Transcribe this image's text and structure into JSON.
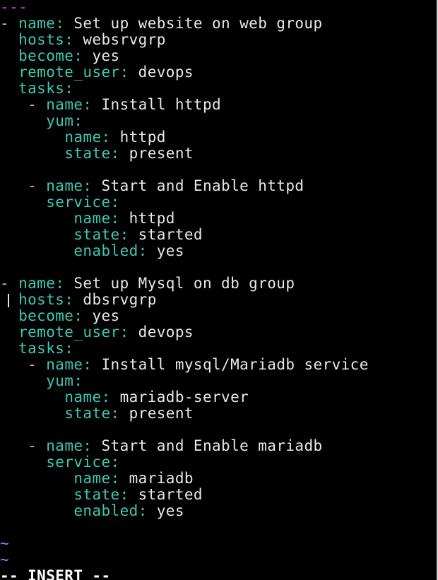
{
  "editor": {
    "lines": [
      [
        {
          "t": "---",
          "c": "m"
        }
      ],
      [
        {
          "t": "- ",
          "c": "d"
        },
        {
          "t": "name:",
          "c": "k"
        },
        {
          "t": " Set up website on web group",
          "c": "v"
        }
      ],
      [
        {
          "t": "  "
        },
        {
          "t": "hosts:",
          "c": "k"
        },
        {
          "t": " websrvgrp",
          "c": "v"
        }
      ],
      [
        {
          "t": "  "
        },
        {
          "t": "become:",
          "c": "k"
        },
        {
          "t": " yes",
          "c": "v"
        }
      ],
      [
        {
          "t": "  "
        },
        {
          "t": "remote_user:",
          "c": "k"
        },
        {
          "t": " devops",
          "c": "v"
        }
      ],
      [
        {
          "t": "  "
        },
        {
          "t": "tasks:",
          "c": "k"
        }
      ],
      [
        {
          "t": "   "
        },
        {
          "t": "- ",
          "c": "d"
        },
        {
          "t": "name:",
          "c": "k"
        },
        {
          "t": " Install httpd",
          "c": "v"
        }
      ],
      [
        {
          "t": "     "
        },
        {
          "t": "yum:",
          "c": "k"
        }
      ],
      [
        {
          "t": "       "
        },
        {
          "t": "name:",
          "c": "k"
        },
        {
          "t": " httpd",
          "c": "v"
        }
      ],
      [
        {
          "t": "       "
        },
        {
          "t": "state:",
          "c": "k"
        },
        {
          "t": " present",
          "c": "v"
        }
      ],
      [],
      [
        {
          "t": "   "
        },
        {
          "t": "- ",
          "c": "d"
        },
        {
          "t": "name:",
          "c": "k"
        },
        {
          "t": " Start and Enable httpd",
          "c": "v"
        }
      ],
      [
        {
          "t": "     "
        },
        {
          "t": "service:",
          "c": "k"
        }
      ],
      [
        {
          "t": "        "
        },
        {
          "t": "name:",
          "c": "k"
        },
        {
          "t": " httpd",
          "c": "v"
        }
      ],
      [
        {
          "t": "        "
        },
        {
          "t": "state:",
          "c": "k"
        },
        {
          "t": " started",
          "c": "v"
        }
      ],
      [
        {
          "t": "        "
        },
        {
          "t": "enabled:",
          "c": "k"
        },
        {
          "t": " yes",
          "c": "v"
        }
      ],
      [],
      [
        {
          "t": "- ",
          "c": "d"
        },
        {
          "t": "name:",
          "c": "k"
        },
        {
          "t": " Set up Mysql on db group",
          "c": "v"
        }
      ],
      [
        {
          "t": "  "
        },
        {
          "t": "hosts:",
          "c": "k"
        },
        {
          "t": " dbsrvgrp",
          "c": "v"
        }
      ],
      [
        {
          "t": "  "
        },
        {
          "t": "become:",
          "c": "k"
        },
        {
          "t": " yes",
          "c": "v"
        }
      ],
      [
        {
          "t": "  "
        },
        {
          "t": "remote_user:",
          "c": "k"
        },
        {
          "t": " devops",
          "c": "v"
        }
      ],
      [
        {
          "t": "  "
        },
        {
          "t": "tasks:",
          "c": "k"
        }
      ],
      [
        {
          "t": "   "
        },
        {
          "t": "- ",
          "c": "d"
        },
        {
          "t": "name:",
          "c": "k"
        },
        {
          "t": " Install mysql/Mariadb service",
          "c": "v"
        }
      ],
      [
        {
          "t": "     "
        },
        {
          "t": "yum:",
          "c": "k"
        }
      ],
      [
        {
          "t": "       "
        },
        {
          "t": "name:",
          "c": "k"
        },
        {
          "t": " mariadb-server",
          "c": "v"
        }
      ],
      [
        {
          "t": "       "
        },
        {
          "t": "state:",
          "c": "k"
        },
        {
          "t": " present",
          "c": "v"
        }
      ],
      [],
      [
        {
          "t": "   "
        },
        {
          "t": "- ",
          "c": "d"
        },
        {
          "t": "name:",
          "c": "k"
        },
        {
          "t": " Start and Enable mariadb",
          "c": "v"
        }
      ],
      [
        {
          "t": "     "
        },
        {
          "t": "service:",
          "c": "k"
        }
      ],
      [
        {
          "t": "        "
        },
        {
          "t": "name:",
          "c": "k"
        },
        {
          "t": " mariadb",
          "c": "v"
        }
      ],
      [
        {
          "t": "        "
        },
        {
          "t": "state:",
          "c": "k"
        },
        {
          "t": " started",
          "c": "v"
        }
      ],
      [
        {
          "t": "        "
        },
        {
          "t": "enabled:",
          "c": "k"
        },
        {
          "t": " yes",
          "c": "v"
        }
      ],
      [],
      [
        {
          "t": "~",
          "c": "t"
        }
      ],
      [
        {
          "t": "~",
          "c": "t"
        }
      ]
    ],
    "cursor_line": 18
  },
  "status": {
    "mode": "-- INSERT --"
  },
  "colors": {
    "background": "#000000",
    "key": "#3cc9b2",
    "dash": "#d4c94a",
    "value": "#e8e8e8",
    "document_marker": "#d04ad8",
    "tilde": "#7c8cff"
  }
}
